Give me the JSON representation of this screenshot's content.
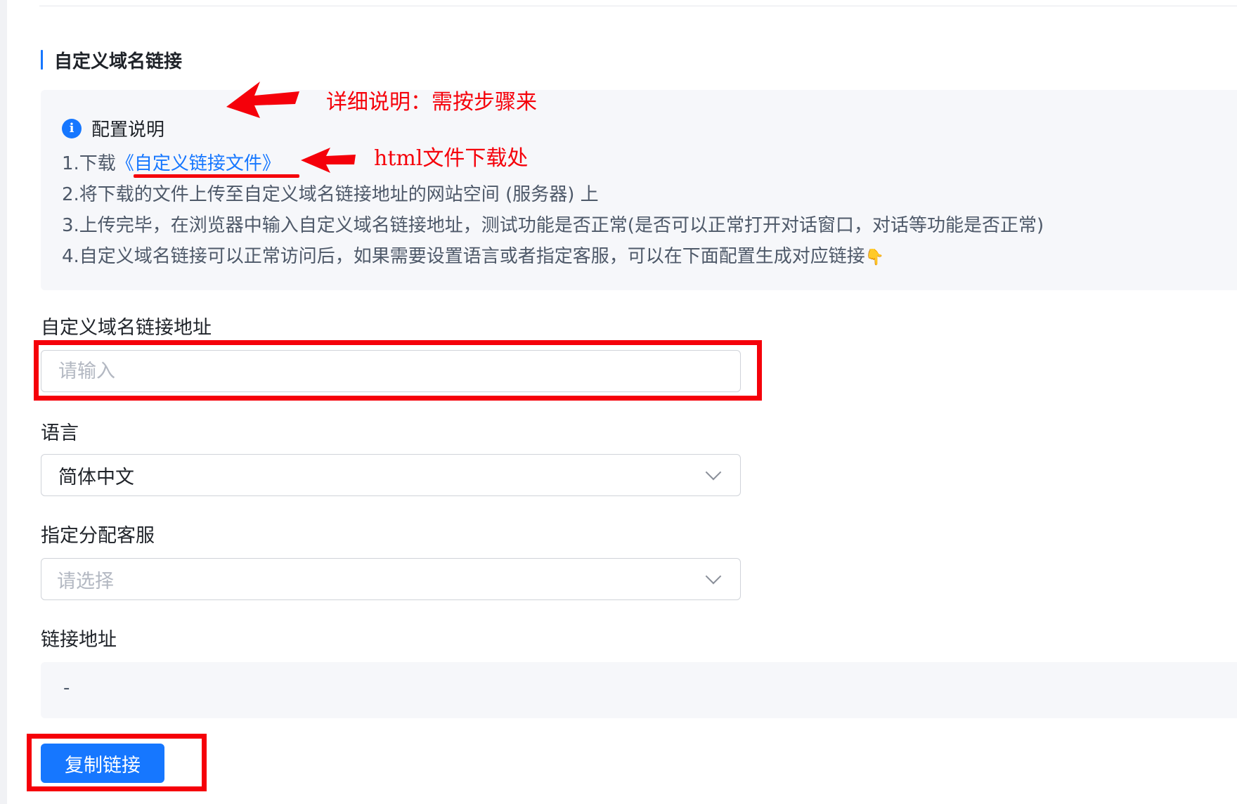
{
  "section": {
    "title": "自定义域名链接"
  },
  "config": {
    "icon": "info-icon",
    "title": "配置说明",
    "step1_prefix": "1.下载",
    "step1_link": "《自定义链接文件》",
    "step2": "2.将下载的文件上传至自定义域名链接地址的网站空间 (服务器) 上",
    "step3": "3.上传完毕，在浏览器中输入自定义域名链接地址，测试功能是否正常(是否可以正常打开对话窗口，对话等功能是否正常)",
    "step4": "4.自定义域名链接可以正常访问后，如果需要设置语言或者指定客服，可以在下面配置生成对应链接",
    "step4_emoji": "👇"
  },
  "form": {
    "domain_label": "自定义域名链接地址",
    "domain_placeholder": "请输入",
    "language_label": "语言",
    "language_value": "简体中文",
    "agent_label": "指定分配客服",
    "agent_placeholder": "请选择",
    "link_label": "链接地址",
    "link_value": "-",
    "copy_button": "复制链接"
  },
  "annotations": {
    "note1": "详细说明：需按步骤来",
    "note2": "html文件下载处",
    "color": "#f5000a"
  },
  "colors": {
    "primary": "#1677ff",
    "panel_bg": "#f6f7fa"
  }
}
